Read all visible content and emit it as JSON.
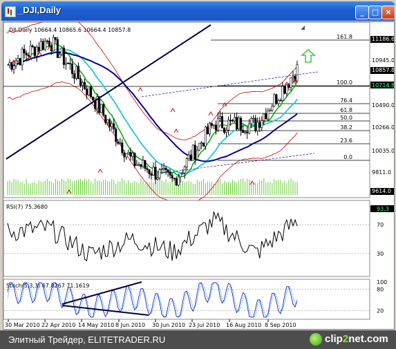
{
  "window": {
    "title": "_DJI,Daily",
    "btn_minimize": "_",
    "btn_maximize": "□",
    "btn_close": "×"
  },
  "chart_header": "_DJI,Daily  10664.4 10865.6 10664.4 10857.8",
  "rsi_header": "RSI(7) 75.3680",
  "stoch_header": "Stoch(5,3,3) 67.8267 71.1619",
  "price_axis_labels": [
    "11186.6",
    "10945.0",
    "10857.8",
    "10714.8",
    "10490.0",
    "10266.0",
    "10035.0",
    "9811.0",
    "9614.0"
  ],
  "rsi_axis_labels": [
    "93.3",
    "70",
    "30"
  ],
  "stoch_axis_labels": [
    "100",
    "80",
    "20"
  ],
  "fib_labels": [
    "161.8",
    "100.0",
    "76.4",
    "61.8",
    "50.0",
    "38.2",
    "23.6",
    "0.0"
  ],
  "date_labels": [
    "30 Mar 2010",
    "22 Apr 2010",
    "14 May 2010",
    "8 Jun 2010",
    "30 Jun 2010",
    "23 Jul 2010",
    "16 Aug 2010",
    "8 Sep 2010"
  ],
  "footer": {
    "caption": "Элитный Трейдер, ELITETRADER.RU",
    "brand_prefix": "clip",
    "brand_two": "2",
    "brand_suffix": "net.com"
  },
  "colors": {
    "up_arrow": "#44cc44",
    "bollinger": "#cc0000",
    "ma_fast": "#00aa00",
    "ma_mid": "#33cccc",
    "ma_slow": "#000099",
    "volume": "#66cc33",
    "stoch_main": "#0000cc",
    "stoch_signal": "#33aacc"
  },
  "chart_data": {
    "type": "line",
    "x": [
      "30 Mar 2010",
      "22 Apr 2010",
      "14 May 2010",
      "8 Jun 2010",
      "30 Jun 2010",
      "23 Jul 2010",
      "16 Aug 2010",
      "8 Sep 2010"
    ],
    "close": [
      10900,
      11150,
      10620,
      9950,
      9750,
      10320,
      10310,
      10857.8
    ],
    "rsi": [
      60,
      65,
      28,
      50,
      32,
      76,
      30,
      75.4
    ],
    "stoch": [
      72,
      80,
      25,
      60,
      20,
      90,
      15,
      67.8
    ],
    "y_range": [
      9614,
      11186.6
    ],
    "rsi_range": [
      0,
      100
    ],
    "stoch_range": [
      0,
      100
    ]
  }
}
